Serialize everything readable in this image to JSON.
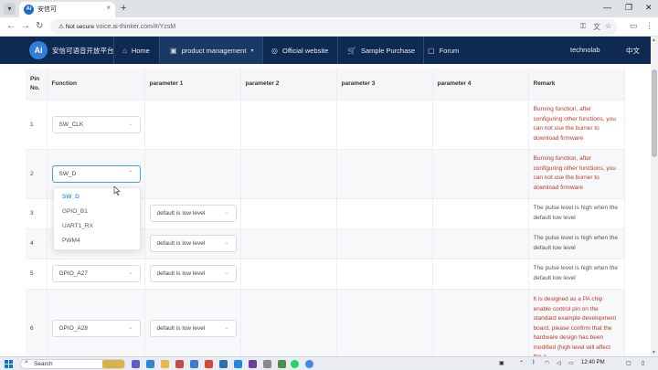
{
  "browser": {
    "tab_title": "安信可",
    "url": "voice.ai-thinker.com/#/YzsM",
    "security_label": "Not secure",
    "new_tab_glyph": "+",
    "tab_close_glyph": "×"
  },
  "site": {
    "brand_logo_text": "Ai",
    "brand_name": "安信可语音开放平台",
    "nav": [
      {
        "label": "Home",
        "icon": "home-icon"
      },
      {
        "label": "product management",
        "icon": "box-icon"
      },
      {
        "label": "Official website",
        "icon": "ai-circle-icon"
      },
      {
        "label": "Sample Purchase",
        "icon": "cart-icon"
      },
      {
        "label": "Forum",
        "icon": "forum-icon"
      }
    ],
    "user": "technolab",
    "language": "中文",
    "colors": {
      "nav_bg": "#0f2a52",
      "accent": "#409eff",
      "remark_red": "#c0392b"
    }
  },
  "table": {
    "headers": [
      "Pin\nNo.",
      "Function",
      "parameter 1",
      "parameter 2",
      "parameter 3",
      "parameter 4",
      "Remark"
    ],
    "rows": [
      {
        "pin": "1",
        "function": "SW_CLK",
        "param1": "",
        "remark": "Burning function, after configuring other functions, you can not use the burner to download firmware",
        "remark_style": "red"
      },
      {
        "pin": "2",
        "function": "SW_D",
        "param1": "",
        "remark": "Burning function, after configuring other functions, you can not use the burner to download firmware",
        "remark_style": "red"
      },
      {
        "pin": "3",
        "function": "",
        "param1": "default is low level",
        "remark": "The pulse level is high when the default low level",
        "remark_style": "gray"
      },
      {
        "pin": "4",
        "function": "",
        "param1": "default is low level",
        "remark": "The pulse level is high when the default low level",
        "remark_style": "gray"
      },
      {
        "pin": "5",
        "function": "GPIO_A27",
        "param1": "default is low level",
        "remark": "The pulse level is high when the default low level",
        "remark_style": "gray"
      },
      {
        "pin": "6",
        "function": "GPIO_A28",
        "param1": "default is low level",
        "remark": "It is designed as a PA chip enable control pin on the standard example development board, please confirm that the hardware design has been modified (high level will affect the a",
        "remark_style": "red"
      }
    ]
  },
  "dropdown": {
    "options": [
      "SW_D",
      "GPIO_B1",
      "UART1_RX",
      "PWM4"
    ],
    "selected": "SW_D"
  },
  "taskbar": {
    "search_label": "Search",
    "time": "12:40 PM"
  }
}
